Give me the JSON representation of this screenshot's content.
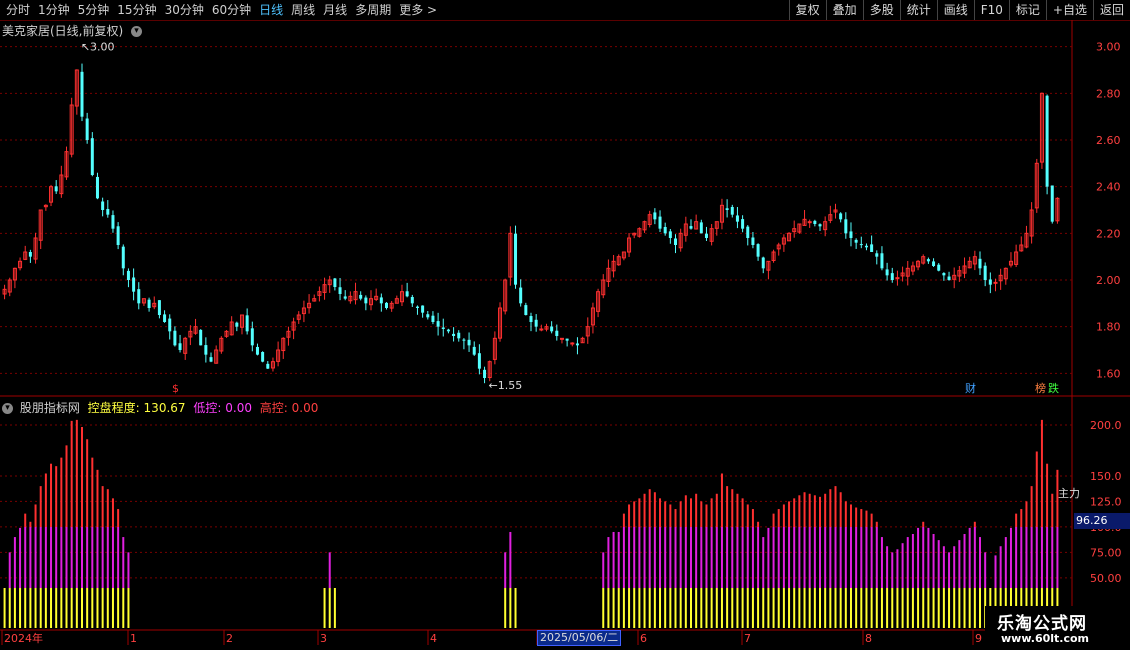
{
  "toolbar": {
    "left_items": [
      "分时",
      "1分钟",
      "5分钟",
      "15分钟",
      "30分钟",
      "60分钟",
      "日线",
      "周线",
      "月线",
      "多周期",
      "更多 >"
    ],
    "active_item": "日线",
    "right_buttons": [
      "复权",
      "叠加",
      "多股",
      "统计",
      "画线",
      "F10",
      "标记",
      "+自选",
      "返回"
    ]
  },
  "main_chart": {
    "title": "美克家居(日线,前复权)",
    "high_label": "3.00",
    "low_label": "1.55",
    "y_ticks": [
      "3.00",
      "2.80",
      "2.60",
      "2.40",
      "2.20",
      "2.00",
      "1.80",
      "1.60"
    ],
    "ylim": [
      1.52,
      3.05
    ],
    "markers": {
      "cai": "财",
      "bang": "榜",
      "die": "跌"
    }
  },
  "sub_chart": {
    "name": "股朋指标网",
    "label_main": "控盘程度:",
    "value_main": "130.67",
    "label_low": "低控:",
    "value_low": "0.00",
    "label_high": "高控:",
    "value_high": "0.00",
    "y_ticks": [
      "200.0",
      "150.0",
      "125.0",
      "100.0",
      "75.00",
      "50.00"
    ],
    "side_label": "主力",
    "current_value": "96.26"
  },
  "x_axis": {
    "labels": [
      "2024年",
      "1",
      "2",
      "3",
      "4",
      "5",
      "6",
      "7",
      "8",
      "9"
    ],
    "highlight_date": "2025/05/06/二"
  },
  "watermark": {
    "title": "乐淘公式网",
    "url": "www.60lt.com"
  },
  "colors": {
    "up": "#ff3030",
    "down": "#54ffff",
    "magenta": "#e020e0",
    "yellow": "#ffff30",
    "grid": "#7a0000"
  },
  "chart_data": {
    "type": "candlestick",
    "series": [
      {
        "name": "",
        "values": [
          1.96,
          2.0,
          2.05,
          2.08,
          2.12,
          2.1,
          2.18,
          2.3,
          2.32,
          2.4,
          2.38,
          2.45,
          2.55,
          2.75,
          2.9,
          2.7,
          2.6,
          2.45,
          2.35,
          2.3,
          2.28,
          2.22,
          2.15,
          2.05,
          2.0,
          1.95,
          1.9,
          1.92,
          1.88,
          1.9,
          1.85,
          1.82,
          1.78,
          1.72,
          1.7,
          1.75,
          1.78,
          1.8,
          1.72,
          1.68,
          1.65,
          1.7,
          1.75,
          1.78,
          1.82,
          1.8,
          1.85,
          1.78,
          1.72,
          1.68,
          1.65,
          1.62,
          1.65,
          1.7,
          1.75,
          1.78,
          1.82,
          1.85,
          1.88,
          1.9,
          1.92,
          1.95,
          1.98,
          2.0,
          1.97,
          1.94,
          1.92,
          1.93,
          1.95,
          1.92,
          1.9,
          1.92,
          1.93,
          1.9,
          1.88,
          1.9,
          1.92,
          1.95,
          1.93,
          1.9,
          1.88,
          1.86,
          1.84,
          1.82,
          1.8,
          1.79,
          1.78,
          1.76,
          1.75,
          1.74,
          1.72,
          1.68,
          1.62,
          1.58,
          1.65,
          1.75,
          1.88,
          2.0,
          2.2,
          1.98,
          1.9,
          1.85,
          1.82,
          1.8,
          1.79,
          1.8,
          1.78,
          1.76,
          1.75,
          1.74,
          1.73,
          1.72,
          1.75,
          1.8,
          1.88,
          1.95,
          2.0,
          2.05,
          2.08,
          2.1,
          2.12,
          2.18,
          2.2,
          2.22,
          2.25,
          2.28,
          2.26,
          2.22,
          2.2,
          2.18,
          2.15,
          2.2,
          2.24,
          2.22,
          2.25,
          2.2,
          2.18,
          2.22,
          2.25,
          2.32,
          2.3,
          2.28,
          2.25,
          2.22,
          2.18,
          2.15,
          2.1,
          2.05,
          2.08,
          2.12,
          2.15,
          2.18,
          2.2,
          2.22,
          2.24,
          2.26,
          2.25,
          2.24,
          2.23,
          2.25,
          2.28,
          2.3,
          2.26,
          2.2,
          2.18,
          2.16,
          2.15,
          2.14,
          2.12,
          2.1,
          2.05,
          2.02,
          2.0,
          2.01,
          2.03,
          2.05,
          2.06,
          2.08,
          2.1,
          2.08,
          2.06,
          2.04,
          2.02,
          2.0,
          2.02,
          2.04,
          2.06,
          2.08,
          2.1,
          2.05,
          2.0,
          1.98,
          1.99,
          2.02,
          2.05,
          2.08,
          2.12,
          2.15,
          2.2,
          2.3,
          2.5,
          2.8,
          2.4,
          2.25,
          2.35
        ]
      }
    ],
    "sub_series_value": 130.67
  }
}
